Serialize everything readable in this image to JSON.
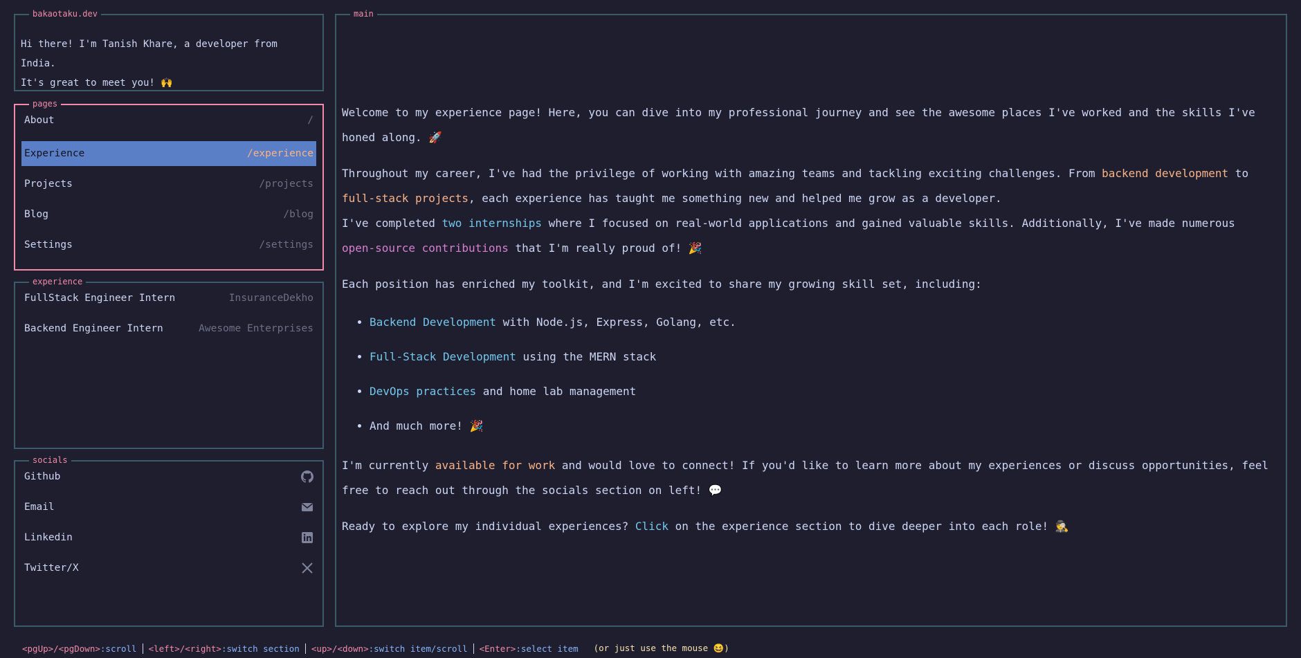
{
  "about": {
    "title": "bakaotaku.dev",
    "line1": "Hi there! I'm Tanish Khare, a developer from India.",
    "line2": "It's great to meet you! 🙌"
  },
  "pages": {
    "title": "pages",
    "items": [
      {
        "label": "About",
        "path": "/"
      },
      {
        "label": "Experience",
        "path": "/experience"
      },
      {
        "label": "Projects",
        "path": "/projects"
      },
      {
        "label": "Blog",
        "path": "/blog"
      },
      {
        "label": "Settings",
        "path": "/settings"
      }
    ],
    "selected": "Experience"
  },
  "experience": {
    "title": "experience",
    "items": [
      {
        "role": "FullStack Engineer Intern",
        "company": "InsuranceDekho"
      },
      {
        "role": "Backend Engineer Intern",
        "company": "Awesome Enterprises"
      }
    ]
  },
  "socials": {
    "title": "socials",
    "items": [
      {
        "label": "Github",
        "icon": "github-icon"
      },
      {
        "label": "Email",
        "icon": "email-icon"
      },
      {
        "label": "Linkedin",
        "icon": "linkedin-icon"
      },
      {
        "label": "Twitter/X",
        "icon": "x-icon"
      }
    ]
  },
  "main": {
    "title": "main",
    "intro": "Welcome to my experience page! Here, you can dive into my professional journey and see the awesome places I've worked and the skills I've honed along. 🚀",
    "p2": {
      "a": "Throughout my career, I've had the privilege of working with amazing teams and tackling exciting challenges. From ",
      "h1": "backend development",
      "b": " to ",
      "h2": "full-stack projects",
      "c": ", each experience has taught me something new and helped me grow as a developer."
    },
    "p3": {
      "a": "I've completed ",
      "h1": "two internships",
      "b": " where I focused on real-world applications and gained valuable skills. Additionally, I've made numerous ",
      "h2": "open-source contributions",
      "c": " that I'm really proud of! 🎉"
    },
    "p4": "Each position has enriched my toolkit, and I'm excited to share my growing skill set, including:",
    "skills": [
      {
        "h": "Backend Development",
        "t": " with Node.js, Express, Golang, etc."
      },
      {
        "h": "Full-Stack Development",
        "t": " using the MERN stack"
      },
      {
        "h": "DevOps practices",
        "t": " and home lab management"
      },
      {
        "h": "",
        "t": "And much more! 🎉"
      }
    ],
    "p5": {
      "a": "I'm currently ",
      "h": "available for work",
      "b": " and would love to connect! If you'd like to learn more about my experiences or discuss opportunities, feel free to reach out through the socials section on left! 💬"
    },
    "p6": {
      "a": "Ready to explore my individual experiences? ",
      "h": "Click",
      "b": " on the experience section to dive deeper into each role! 🕵️"
    }
  },
  "footer": {
    "items": [
      {
        "keys": "<pgUp>/<pgDown>",
        "action": ":scroll"
      },
      {
        "keys": "<left>/<right>",
        "action": ":switch section"
      },
      {
        "keys": "<up>/<down>",
        "action": ":switch item/scroll"
      },
      {
        "keys": "<Enter>",
        "action": ":select item"
      }
    ],
    "hint": "(or just use the mouse 😆)"
  },
  "colors": {
    "background": "#1e1e2e",
    "border": "#3b5a6a",
    "active_border": "#f38ba8",
    "selection": "#5b7fc7",
    "accent_orange": "#fab387",
    "accent_sky": "#74c7ec",
    "accent_pink": "#d97fd0"
  }
}
